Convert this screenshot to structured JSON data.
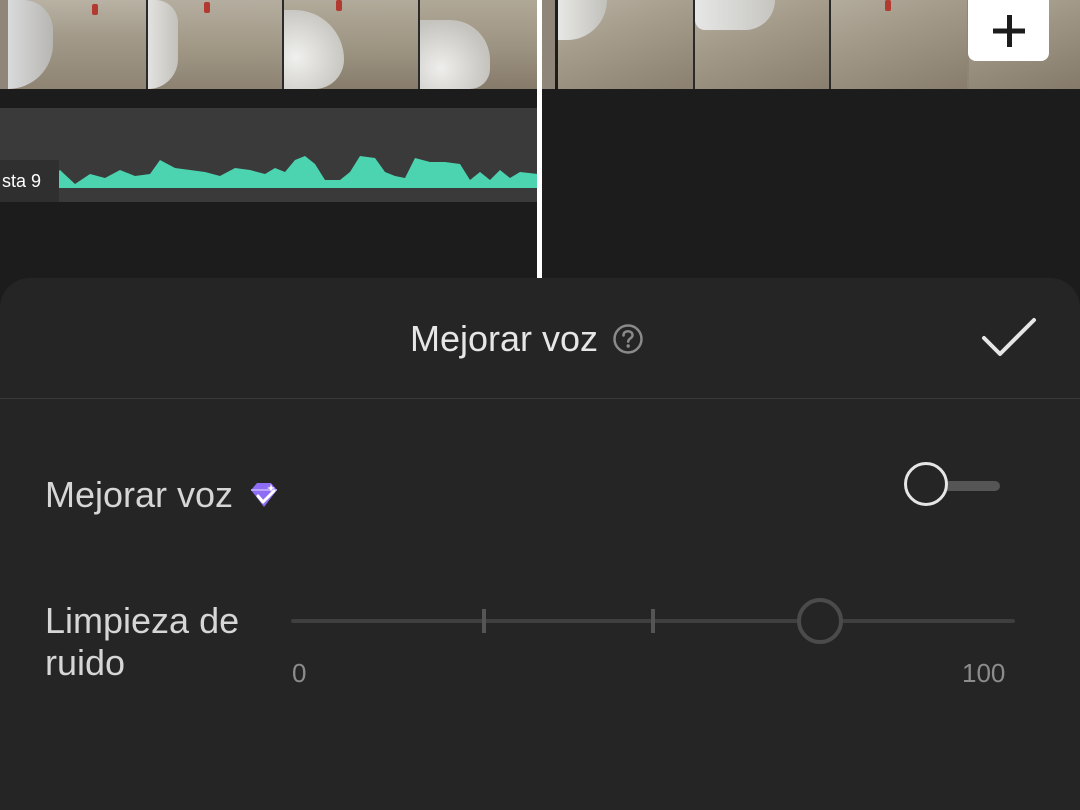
{
  "timeline": {
    "audio_track_label": "sta 9"
  },
  "panel": {
    "title": "Mejorar voz",
    "enhance_voice": {
      "label": "Mejorar voz",
      "enabled": false
    },
    "noise_reduction": {
      "label": "Limpieza de ruido",
      "min_label": "0",
      "max_label": "100",
      "value": 73
    }
  },
  "icons": [
    "add-clip-icon",
    "help-circle-icon",
    "checkmark-icon",
    "premium-diamond-icon"
  ],
  "colors": {
    "waveform": "#4cd4b0",
    "panel_background": "#252525",
    "premium_badge": "#8e6cf5"
  }
}
